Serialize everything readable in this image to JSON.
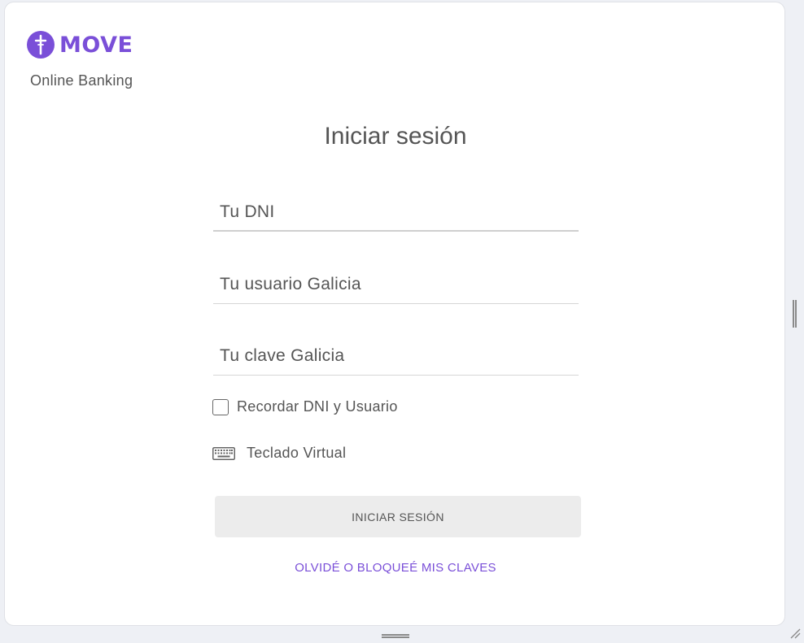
{
  "brand": {
    "name": "MOVE",
    "subtitle": "Online Banking",
    "color": "#7a4fd8"
  },
  "login": {
    "title": "Iniciar sesión",
    "fields": {
      "dni_placeholder": "Tu DNI",
      "user_placeholder": "Tu usuario Galicia",
      "password_placeholder": "Tu clave Galicia"
    },
    "remember_label": "Recordar DNI y Usuario",
    "remember_checked": false,
    "virtual_keyboard_label": "Teclado Virtual",
    "virtual_keyboard_icon": "keyboard-icon",
    "submit_label": "INICIAR SESIÓN",
    "forgot_label": "OLVIDÉ O BLOQUEÉ MIS CLAVES"
  }
}
